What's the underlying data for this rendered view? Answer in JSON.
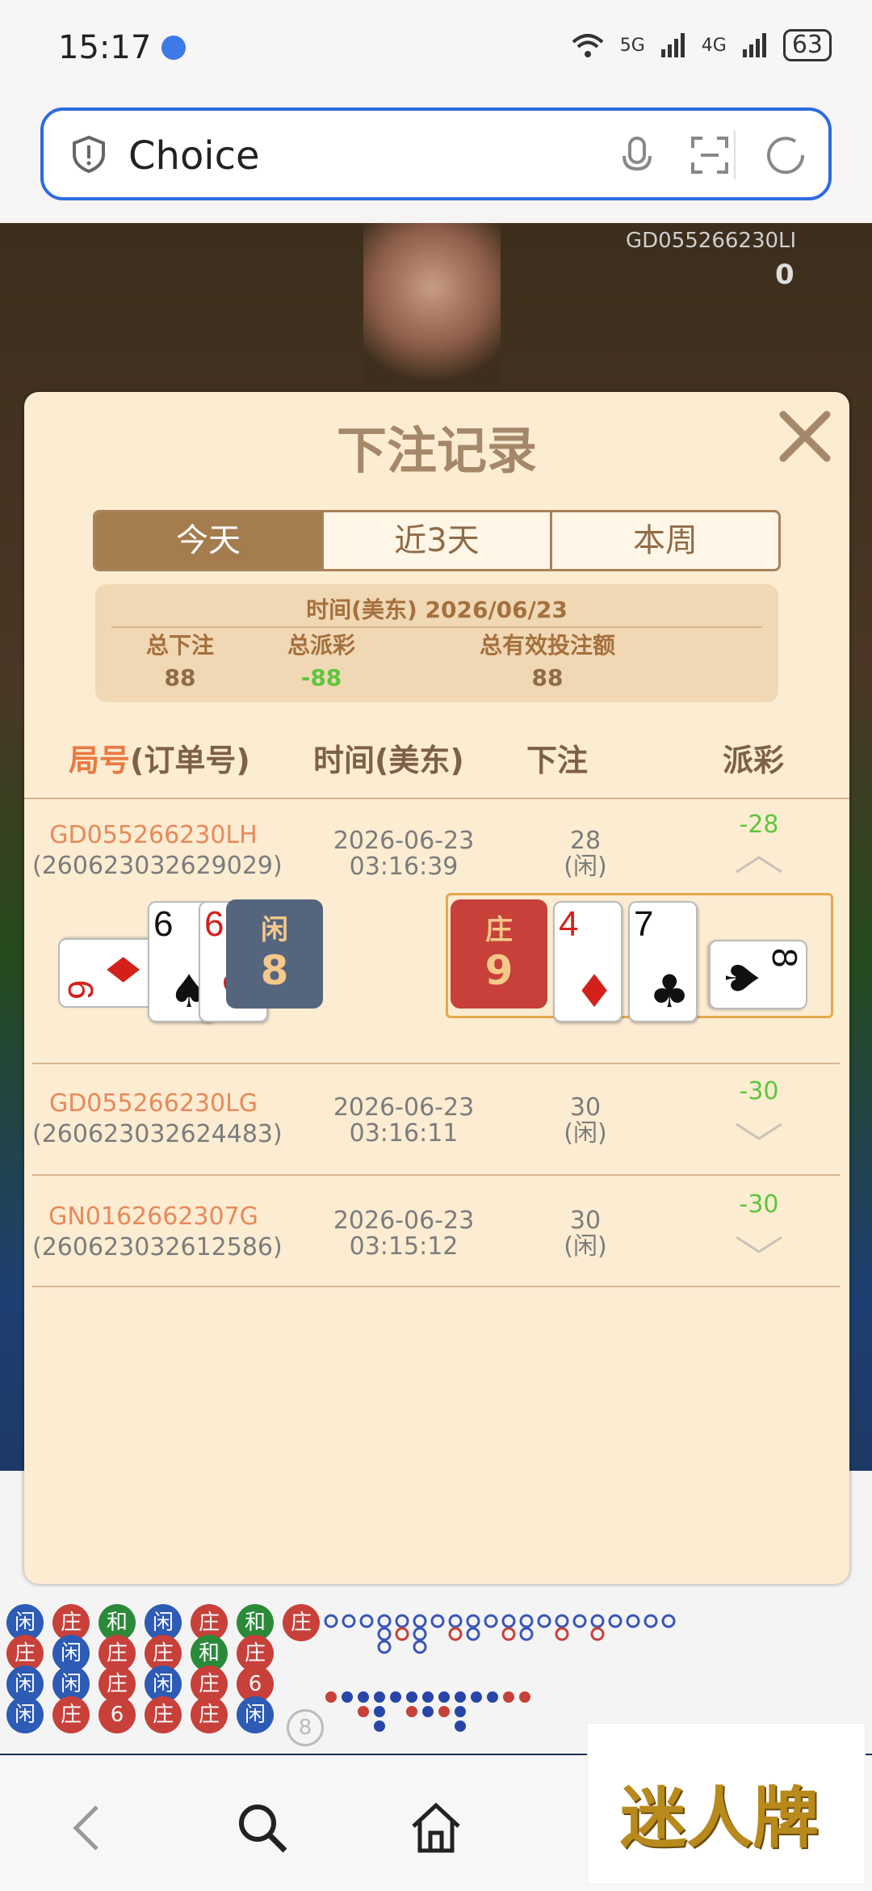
{
  "status_bar": {
    "time": "15:17",
    "net1": "5G",
    "net2": "4G",
    "battery": "63"
  },
  "address_bar": {
    "text": "Choice"
  },
  "background": {
    "table_id": "GD055266230LI",
    "count": "0"
  },
  "modal": {
    "title": "下注记录",
    "tabs": [
      {
        "label": "今天",
        "active": true
      },
      {
        "label": "近3天",
        "active": false
      },
      {
        "label": "本周",
        "active": false
      }
    ],
    "summary": {
      "time_label": "时间(美东) 2026/06/23",
      "total_bet_label": "总下注",
      "total_bet": "88",
      "total_payout_label": "总派彩",
      "total_payout": "-88",
      "total_valid_label": "总有效投注额",
      "total_valid": "88"
    },
    "headers": {
      "round": "局号",
      "order": "(订单号)",
      "time": "时间(美东)",
      "bet": "下注",
      "payout": "派彩"
    },
    "rows": [
      {
        "round_id": "GD055266230LH",
        "order_id": "(260623032629029)",
        "date": "2026-06-23",
        "clock": "03:16:39",
        "bet": "28",
        "bet_side": "(闲)",
        "payout": "-28",
        "expanded": true
      },
      {
        "round_id": "GD055266230LG",
        "order_id": "(260623032624483)",
        "date": "2026-06-23",
        "clock": "03:16:11",
        "bet": "30",
        "bet_side": "(闲)",
        "payout": "-30",
        "expanded": false
      },
      {
        "round_id": "GN0162662307G",
        "order_id": "(260623032612586)",
        "date": "2026-06-23",
        "clock": "03:15:12",
        "bet": "30",
        "bet_side": "(闲)",
        "payout": "-30",
        "expanded": false
      }
    ],
    "result": {
      "player_label": "闲",
      "player_score": "8",
      "banker_label": "庄",
      "banker_score": "9",
      "player_cards": [
        {
          "rank": "9",
          "suit": "♦"
        },
        {
          "rank": "6",
          "suit": "♠"
        },
        {
          "rank": "6",
          "suit": "♥"
        }
      ],
      "banker_cards": [
        {
          "rank": "4",
          "suit": "♦"
        },
        {
          "rank": "7",
          "suit": "♣"
        },
        {
          "rank": "8",
          "suit": "♠"
        }
      ]
    }
  },
  "bead_road": {
    "rows": [
      [
        "闲",
        "庄",
        "和",
        "闲",
        "庄",
        "和",
        "庄"
      ],
      [
        "庄",
        "闲",
        "庄",
        "庄",
        "和",
        "庄"
      ],
      [
        "闲",
        "闲",
        "庄",
        "闲",
        "庄",
        "6"
      ],
      [
        "闲",
        "庄",
        "6",
        "庄",
        "庄",
        "闲"
      ]
    ],
    "count_label": "8"
  },
  "logo": {
    "text": "迷人牌"
  },
  "colors": {
    "accent": "#2d6be0",
    "modal_bg": "#fcecd2",
    "tab_active": "#a47c4e",
    "positive": "#5ec63c",
    "link": "#e8895a",
    "banker": "#c8403a",
    "player": "#56657e"
  }
}
